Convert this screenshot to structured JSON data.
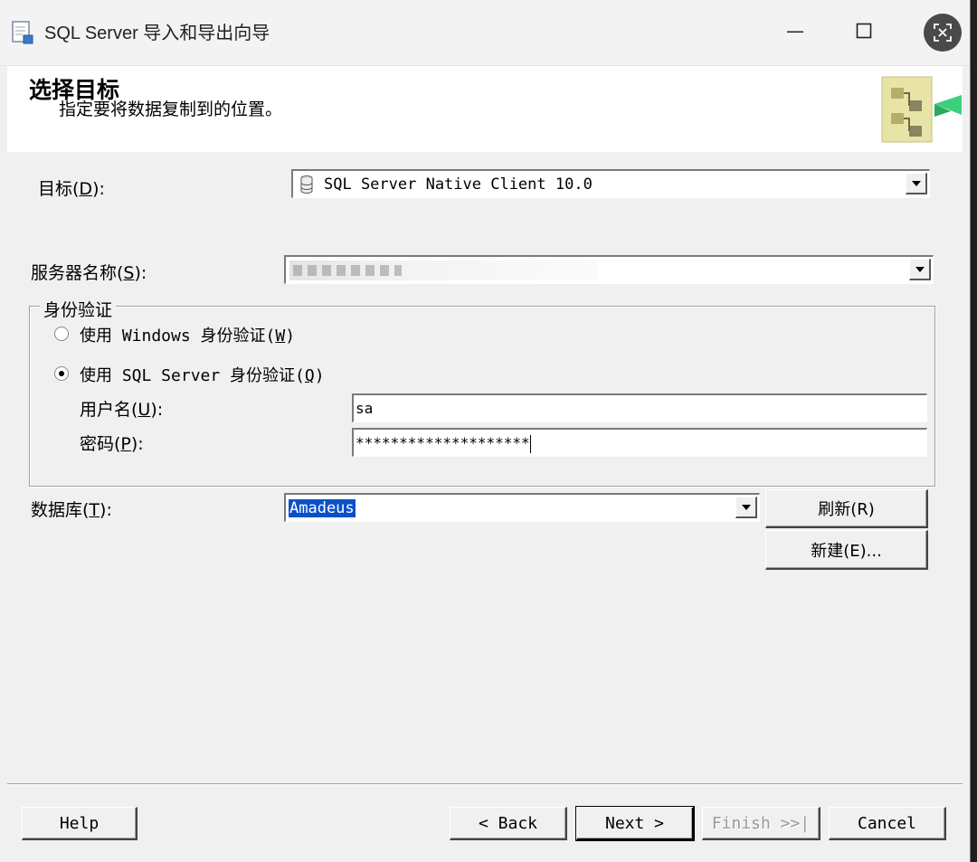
{
  "window": {
    "title": "SQL Server 导入和导出向导",
    "minimize_glyph": "—",
    "maximize_glyph": "☐",
    "close_icon": "screenshot-close-icon"
  },
  "header": {
    "title": "选择目标",
    "subtitle": "指定要将数据复制到的位置。"
  },
  "destination": {
    "label_prefix": "目标(",
    "label_key": "D",
    "label_suffix": "):",
    "value": "SQL Server Native Client 10.0"
  },
  "server": {
    "label_prefix": "服务器名称(",
    "label_key": "S",
    "label_suffix": "):",
    "value": ""
  },
  "auth": {
    "legend": "身份验证",
    "windows_prefix": "使用 Windows 身份验证(",
    "windows_key": "W",
    "windows_suffix": ")",
    "sql_prefix": "使用 SQL Server 身份验证(",
    "sql_key": "Q",
    "sql_suffix": ")",
    "username_prefix": "用户名(",
    "username_key": "U",
    "username_suffix": "):",
    "username_value": "sa",
    "password_prefix": "密码(",
    "password_key": "P",
    "password_suffix": "):",
    "password_value": "********************",
    "selected": "sql"
  },
  "database": {
    "label_prefix": "数据库(",
    "label_key": "T",
    "label_suffix": "):",
    "value": "Amadeus",
    "refresh_label": "刷新(R)",
    "new_label": "新建(E)..."
  },
  "footer": {
    "help": "Help",
    "back": "< Back",
    "next": "Next >",
    "finish": "Finish >>|",
    "cancel": "Cancel"
  }
}
